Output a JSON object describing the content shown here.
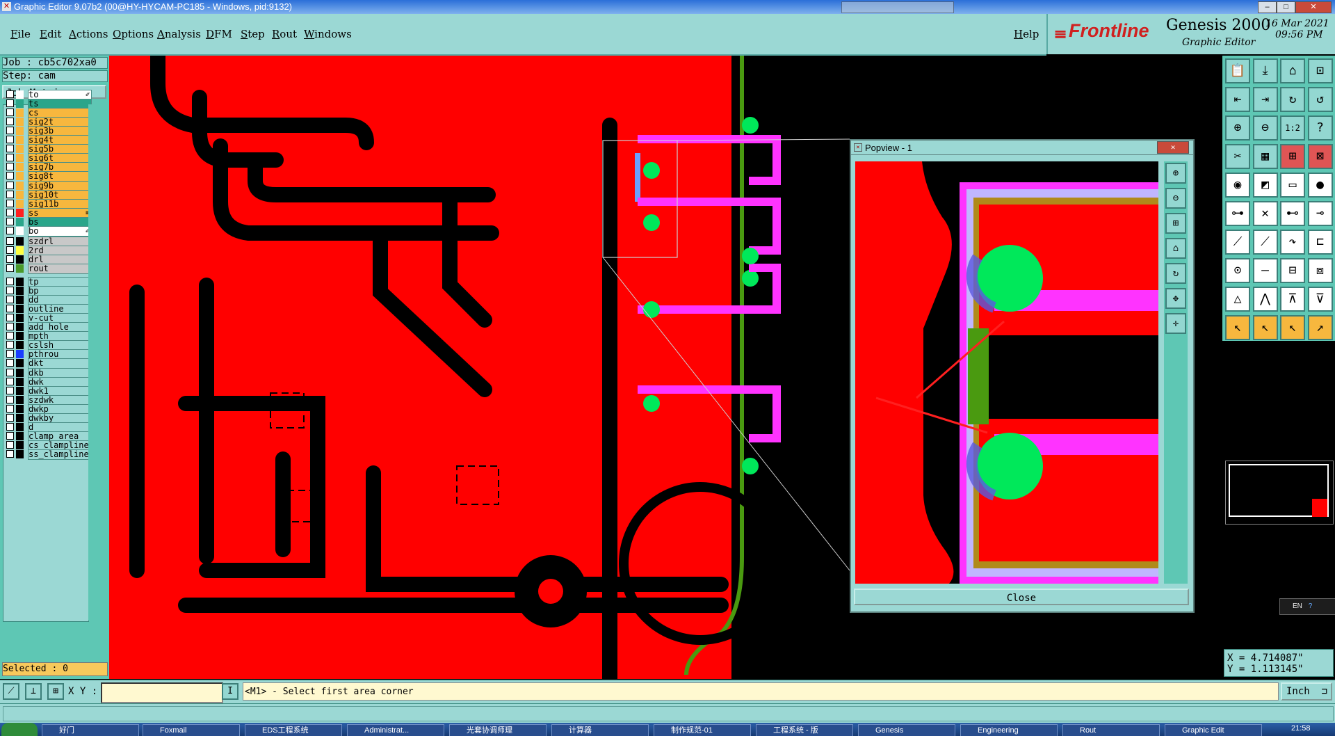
{
  "window": {
    "title": "Graphic Editor 9.07b2 (00@HY-HYCAM-PC185 - Windows, pid:9132)"
  },
  "menu": {
    "items": [
      "File",
      "Edit",
      "Actions",
      "Options",
      "Analysis",
      "DFM",
      "Step",
      "Rout",
      "Windows"
    ],
    "help": "Help"
  },
  "brand": {
    "company": "Frontline",
    "product": "Genesis 2000",
    "subtitle": "Graphic Editor",
    "date": "16 Mar 2021",
    "time": "09:56 PM"
  },
  "job": {
    "job_label": "Job : cb5c702xa0",
    "step_label": "Step: cam",
    "matrix_button": "Job Matrix ..."
  },
  "layers_board": [
    {
      "name": "to",
      "color": "#ffffff",
      "bg": "#ffffff",
      "sym": "✐"
    },
    {
      "name": "ts",
      "color": "#2aa58a",
      "bg": "#2aa58a"
    },
    {
      "name": "cs",
      "color": "#f7b73e",
      "bg": "#f7b73e"
    },
    {
      "name": "sig2t",
      "color": "#f7b73e",
      "bg": "#f7b73e"
    },
    {
      "name": "sig3b",
      "color": "#f7b73e",
      "bg": "#f7b73e"
    },
    {
      "name": "sig4t",
      "color": "#f7b73e",
      "bg": "#f7b73e"
    },
    {
      "name": "sig5b",
      "color": "#f7b73e",
      "bg": "#f7b73e"
    },
    {
      "name": "sig6t",
      "color": "#f7b73e",
      "bg": "#f7b73e"
    },
    {
      "name": "sig7b",
      "color": "#f7b73e",
      "bg": "#f7b73e"
    },
    {
      "name": "sig8t",
      "color": "#f7b73e",
      "bg": "#f7b73e"
    },
    {
      "name": "sig9b",
      "color": "#f7b73e",
      "bg": "#f7b73e"
    },
    {
      "name": "sig10t",
      "color": "#f7b73e",
      "bg": "#f7b73e"
    },
    {
      "name": "sig11b",
      "color": "#f7b73e",
      "bg": "#f7b73e"
    },
    {
      "name": "ss",
      "color": "#ff2020",
      "bg": "#f7b73e",
      "sym": "≡",
      "active": true
    },
    {
      "name": "bs",
      "color": "#2aa58a",
      "bg": "#2aa58a"
    },
    {
      "name": "bo",
      "color": "#ffffff",
      "bg": "#ffffff",
      "sym": "✐"
    }
  ],
  "layers_drill": [
    {
      "name": "szdrl",
      "color": "#000000",
      "bg": "#c8c8c8"
    },
    {
      "name": "2rd",
      "color": "#ffff40",
      "bg": "#c8c8c8"
    },
    {
      "name": "drl",
      "color": "#000000",
      "bg": "#c8c8c8"
    },
    {
      "name": "rout",
      "color": "#4a9a2a",
      "bg": "#c8c8c8"
    }
  ],
  "layers_misc": [
    {
      "name": "tp",
      "color": "#000000",
      "bg": "#9bd8d4"
    },
    {
      "name": "bp",
      "color": "#000000",
      "bg": "#9bd8d4"
    },
    {
      "name": "dd",
      "color": "#000000",
      "bg": "#9bd8d4"
    },
    {
      "name": "outline",
      "color": "#000000",
      "bg": "#9bd8d4"
    },
    {
      "name": "v-cut",
      "color": "#000000",
      "bg": "#9bd8d4"
    },
    {
      "name": "add_hole",
      "color": "#000000",
      "bg": "#9bd8d4"
    },
    {
      "name": "mpth",
      "color": "#000000",
      "bg": "#9bd8d4"
    },
    {
      "name": "cslsh",
      "color": "#000000",
      "bg": "#9bd8d4"
    },
    {
      "name": "pthrou",
      "color": "#1a3cff",
      "bg": "#9bd8d4"
    },
    {
      "name": "dkt",
      "color": "#000000",
      "bg": "#9bd8d4"
    },
    {
      "name": "dkb",
      "color": "#000000",
      "bg": "#9bd8d4"
    },
    {
      "name": "dwk",
      "color": "#000000",
      "bg": "#9bd8d4"
    },
    {
      "name": "dwk1",
      "color": "#000000",
      "bg": "#9bd8d4"
    },
    {
      "name": "szdwk",
      "color": "#000000",
      "bg": "#9bd8d4"
    },
    {
      "name": "dwkp",
      "color": "#000000",
      "bg": "#9bd8d4"
    },
    {
      "name": "dwkby",
      "color": "#000000",
      "bg": "#9bd8d4"
    },
    {
      "name": "d",
      "color": "#000000",
      "bg": "#9bd8d4"
    },
    {
      "name": "clamp_area",
      "color": "#000000",
      "bg": "#9bd8d4"
    },
    {
      "name": "cs_clampline",
      "color": "#000000",
      "bg": "#9bd8d4"
    },
    {
      "name": "ss_clampline",
      "color": "#000000",
      "bg": "#9bd8d4"
    }
  ],
  "selected": "Selected : 0",
  "popview": {
    "title": "Popview - 1",
    "close_label": "Close"
  },
  "coords": {
    "x": "X = 4.714087\"",
    "y": "Y = 1.113145\""
  },
  "ime": "EN",
  "command": {
    "xy_label": "X Y :",
    "xy_value": "",
    "prompt": "<M1> - Select first area corner",
    "units": "Inch"
  },
  "taskbar": {
    "clock": "21:58",
    "tasks": [
      "好门",
      "Foxmail",
      "EDS工程系统",
      "Administrat...",
      "光套协调师理",
      "计算器",
      "制作规范-01",
      "工程系统 - 版",
      "Genesis",
      "Engineering",
      "Rout",
      "Graphic Edit"
    ]
  },
  "colors": {
    "copper": "#ff0000",
    "pad": "#00e85a",
    "mask": "#ff33ff",
    "outline": "#4a9a10",
    "panel": "#9bd8d4"
  }
}
